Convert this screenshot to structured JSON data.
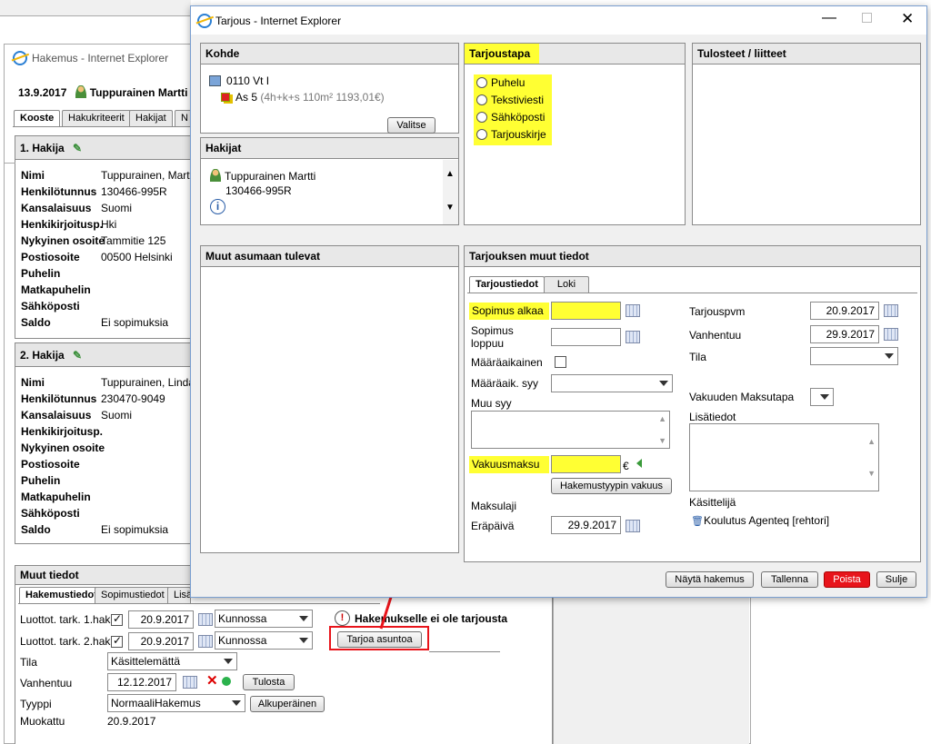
{
  "bg_window": {
    "title": "Hakemus - Internet Explorer",
    "header_date": "13.9.2017",
    "header_person": "Tuppurainen Martti",
    "tabs": [
      "Kooste",
      "Hakukriteerit",
      "Hakijat",
      "N"
    ],
    "hakija1": {
      "title": "1. Hakija",
      "rows": [
        {
          "label": "Nimi",
          "value": "Tuppurainen, Martti"
        },
        {
          "label": "Henkilötunnus",
          "value": "130466-995R"
        },
        {
          "label": "Kansalaisuus",
          "value": "Suomi"
        },
        {
          "label": "Henkikirjoitusp.",
          "value": "Hki"
        },
        {
          "label": "Nykyinen osoite",
          "value": "Tammitie 125"
        },
        {
          "label": "Postiosoite",
          "value": "00500 Helsinki"
        },
        {
          "label": "Puhelin",
          "value": ""
        },
        {
          "label": "Matkapuhelin",
          "value": ""
        },
        {
          "label": "Sähköposti",
          "value": ""
        },
        {
          "label": "Saldo",
          "value": "Ei sopimuksia"
        }
      ]
    },
    "hakija2": {
      "title": "2. Hakija",
      "rows": [
        {
          "label": "Nimi",
          "value": "Tuppurainen, Linda"
        },
        {
          "label": "Henkilötunnus",
          "value": "230470-9049"
        },
        {
          "label": "Kansalaisuus",
          "value": "Suomi"
        },
        {
          "label": "Henkikirjoitusp.",
          "value": ""
        },
        {
          "label": "Nykyinen osoite",
          "value": ""
        },
        {
          "label": "Postiosoite",
          "value": ""
        },
        {
          "label": "Puhelin",
          "value": ""
        },
        {
          "label": "Matkapuhelin",
          "value": ""
        },
        {
          "label": "Sähköposti",
          "value": ""
        },
        {
          "label": "Saldo",
          "value": "Ei sopimuksia"
        }
      ]
    },
    "muut": {
      "title": "Muut tiedot",
      "tabs": [
        "Hakemustiedot",
        "Sopimustiedot",
        "Lisä"
      ],
      "luottot1_label": "Luottot. tark. 1.hak",
      "luottot1_date": "20.9.2017",
      "luottot1_status": "Kunnossa",
      "luottot2_label": "Luottot. tark. 2.hak",
      "luottot2_date": "20.9.2017",
      "luottot2_status": "Kunnossa",
      "no_offer_text": "Hakemukselle ei ole tarjousta",
      "offer_button": "Tarjoa asuntoa",
      "tila_label": "Tila",
      "tila_value": "Käsittelemättä",
      "vanhentuu_label": "Vanhentuu",
      "vanhentuu_value": "12.12.2017",
      "tulosta_button": "Tulosta",
      "tyyppi_label": "Tyyppi",
      "tyyppi_value": "NormaaliHakemus",
      "alkuperainen_button": "Alkuperäinen",
      "muokattu_label": "Muokattu",
      "muokattu_value": "20.9.2017"
    }
  },
  "dialog": {
    "title": "Tarjous - Internet Explorer",
    "kohde": {
      "title": "Kohde",
      "line1": "0110 Vt I",
      "line2_strong": "As 5",
      "line2_detail": "(4h+k+s  110m²  1193,01€)",
      "valitse_button": "Valitse"
    },
    "hakijat": {
      "title": "Hakijat",
      "name": "Tuppurainen Martti",
      "id": "130466-995R"
    },
    "tarjoustapa": {
      "title": "Tarjoustapa",
      "options": [
        "Puhelu",
        "Tekstiviesti",
        "Sähköposti",
        "Tarjouskirje"
      ]
    },
    "tulosteet": {
      "title": "Tulosteet / liitteet"
    },
    "muut_asumaan": {
      "title": "Muut asumaan tulevat"
    },
    "muut_tiedot": {
      "title": "Tarjouksen muut tiedot",
      "tabs": [
        "Tarjoustiedot",
        "Loki"
      ],
      "sopimus_alkaa": "Sopimus alkaa",
      "sopimus_loppuu": "Sopimus loppuu",
      "maaraaikainen": "Määräaikainen",
      "maaraaik_syy": "Määräaik. syy",
      "muu_syy": "Muu syy",
      "vakuusmaksu": "Vakuusmaksu",
      "currency": "€",
      "hakemustyypin_button": "Hakemustyypin vakuus",
      "maksulaji": "Maksulaji",
      "erapaiva": "Eräpäivä",
      "erapaiva_value": "29.9.2017",
      "tarjouspvm": "Tarjouspvm",
      "tarjouspvm_value": "20.9.2017",
      "vanhentuu": "Vanhentuu",
      "vanhentuu_value": "29.9.2017",
      "tila": "Tila",
      "vakuuden_maksutapa": "Vakuuden Maksutapa",
      "lisatiedot": "Lisätiedot",
      "kasittelija": "Käsittelijä",
      "kasittelija_value": "Koulutus Agenteq [rehtori]"
    },
    "buttons": {
      "nayta": "Näytä hakemus",
      "tallenna": "Tallenna",
      "poista": "Poista",
      "sulje": "Sulje"
    }
  },
  "colors": {
    "highlight_yellow": "#ffff33",
    "delete_red": "#e8141b",
    "annotation_red": "#e8141b"
  }
}
